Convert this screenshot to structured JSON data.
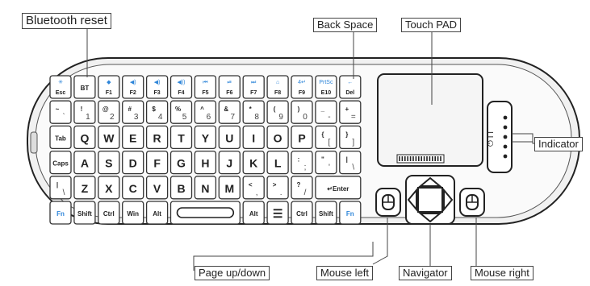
{
  "labels": {
    "bluetooth_reset": "Bluetooth reset",
    "back_space": "Back Space",
    "touch_pad": "Touch PAD",
    "indicator": "Indicator",
    "page_up_down": "Page up/down",
    "mouse_left": "Mouse left",
    "navigator": "Navigator",
    "mouse_right": "Mouse right"
  },
  "keyboard": {
    "rows": [
      [
        {
          "label": "Esc",
          "top": "✳",
          "blue": true
        },
        {
          "label": "BT"
        },
        {
          "label": "F1",
          "top": "◆",
          "blue": true
        },
        {
          "label": "F2",
          "top": "◀)",
          "blue": true
        },
        {
          "label": "F3",
          "top": "◀)",
          "blue": true
        },
        {
          "label": "F4",
          "top": "◀))",
          "blue": true
        },
        {
          "label": "F5",
          "top": "⏮",
          "blue": true
        },
        {
          "label": "F6",
          "top": "⏯",
          "blue": true
        },
        {
          "label": "F7",
          "top": "⏭",
          "blue": true
        },
        {
          "label": "F8",
          "top": "⌂",
          "blue": true
        },
        {
          "label": "F9",
          "top": "4↵",
          "blue": true
        },
        {
          "label": "E10",
          "top": "PrtSc",
          "blue": true
        },
        {
          "label": "Del",
          "top": "←",
          "blue": true
        }
      ],
      [
        {
          "label": "~",
          "sub": "`"
        },
        {
          "label": "!",
          "sub": "1"
        },
        {
          "label": "@",
          "sub": "2"
        },
        {
          "label": "#",
          "sub": "3"
        },
        {
          "label": "$",
          "sub": "4"
        },
        {
          "label": "%",
          "sub": "5"
        },
        {
          "label": "^",
          "sub": "6"
        },
        {
          "label": "&",
          "sub": "7"
        },
        {
          "label": "*",
          "sub": "8"
        },
        {
          "label": "(",
          "sub": "9"
        },
        {
          "label": ")",
          "sub": "0"
        },
        {
          "label": "_",
          "sub": "-"
        },
        {
          "label": "+",
          "sub": "="
        }
      ],
      [
        {
          "label": "Tab"
        },
        {
          "label": "Q"
        },
        {
          "label": "W"
        },
        {
          "label": "E"
        },
        {
          "label": "R"
        },
        {
          "label": "T"
        },
        {
          "label": "Y"
        },
        {
          "label": "U"
        },
        {
          "label": "I"
        },
        {
          "label": "O"
        },
        {
          "label": "P"
        },
        {
          "label": "{",
          "sub": "["
        },
        {
          "label": "}",
          "sub": "]"
        }
      ],
      [
        {
          "label": "Caps"
        },
        {
          "label": "A"
        },
        {
          "label": "S"
        },
        {
          "label": "D"
        },
        {
          "label": "F"
        },
        {
          "label": "G"
        },
        {
          "label": "H"
        },
        {
          "label": "J"
        },
        {
          "label": "K"
        },
        {
          "label": "L"
        },
        {
          "label": ":",
          "sub": ";"
        },
        {
          "label": "\"",
          "sub": "'"
        },
        {
          "label": "|",
          "sub": "\\"
        }
      ],
      [
        {
          "label": "|",
          "sub": "\\"
        },
        {
          "label": "Z"
        },
        {
          "label": "X"
        },
        {
          "label": "C"
        },
        {
          "label": "V"
        },
        {
          "label": "B"
        },
        {
          "label": "N"
        },
        {
          "label": "M"
        },
        {
          "label": "<",
          "sub": ","
        },
        {
          "label": ">",
          "sub": "."
        },
        {
          "label": "?",
          "sub": "/"
        },
        {
          "label": "↵Enter",
          "wide": 2
        }
      ],
      [
        {
          "label": "Fn",
          "blue": true
        },
        {
          "label": "Shift"
        },
        {
          "label": "Ctrl"
        },
        {
          "label": "Win"
        },
        {
          "label": "Alt"
        },
        {
          "label": "",
          "space": true,
          "wide": 3
        },
        {
          "label": "Alt"
        },
        {
          "label": "☰"
        },
        {
          "label": "Ctrl"
        },
        {
          "label": "Shift"
        },
        {
          "label": "Fn",
          "blue": true
        }
      ]
    ]
  },
  "colors": {
    "blue": "#2f86d9",
    "body": "#f3f3f3",
    "key": "#ffffff",
    "outline": "#333333"
  }
}
